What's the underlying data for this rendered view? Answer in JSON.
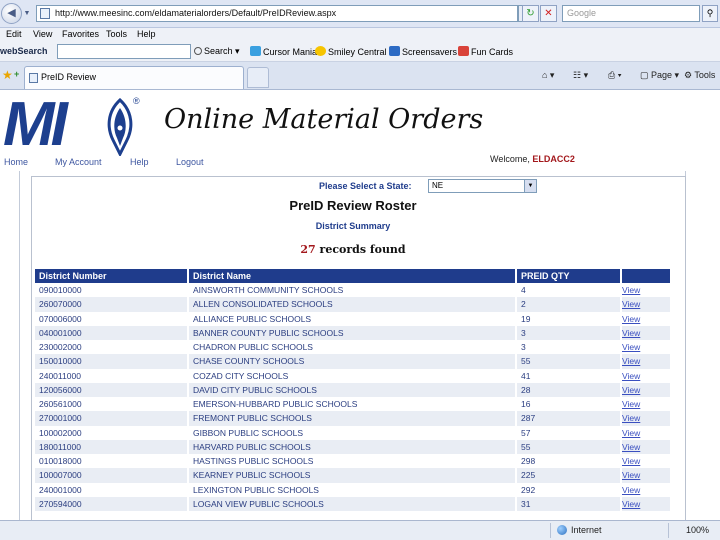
{
  "browser": {
    "address": "http://www.meesinc.com/eldamaterialorders/Default/PreIDReview.aspx",
    "search_placeholder": "Google",
    "menu": [
      "Edit",
      "View",
      "Favorites",
      "Tools",
      "Help"
    ],
    "toolbar": {
      "websearch_label": "webSearch",
      "search_button": "Search",
      "cursor_mania": "Cursor Mania",
      "smiley_central": "Smiley Central",
      "screensavers": "Screensavers",
      "fun_cards": "Fun Cards"
    },
    "tab_title": "PreID Review",
    "commands": {
      "page": "Page",
      "tools": "Tools"
    },
    "status": {
      "zone": "Internet",
      "zoom": "100%"
    }
  },
  "site": {
    "logo_text": "MI",
    "logo_reg": "®",
    "title": "Online Material Orders",
    "nav": {
      "home": "Home",
      "account": "My Account",
      "help": "Help",
      "logout": "Logout"
    },
    "welcome_prefix": "Welcome,",
    "welcome_user": "ELDACC2"
  },
  "page": {
    "state_label": "Please Select a State:",
    "state_value": "NE",
    "roster_title": "PreID Review Roster",
    "district_summary": "District Summary",
    "record_count": "27",
    "records_suffix": "records found",
    "columns": [
      "District Number",
      "District Name",
      "PREID QTY",
      ""
    ],
    "view_label": "View",
    "rows": [
      {
        "number": "090010000",
        "name": "AINSWORTH COMMUNITY SCHOOLS",
        "qty": "4"
      },
      {
        "number": "260070000",
        "name": "ALLEN CONSOLIDATED SCHOOLS",
        "qty": "2"
      },
      {
        "number": "070006000",
        "name": "ALLIANCE PUBLIC SCHOOLS",
        "qty": "19"
      },
      {
        "number": "040001000",
        "name": "BANNER COUNTY PUBLIC SCHOOLS",
        "qty": "3"
      },
      {
        "number": "230002000",
        "name": "CHADRON PUBLIC SCHOOLS",
        "qty": "3"
      },
      {
        "number": "150010000",
        "name": "CHASE COUNTY SCHOOLS",
        "qty": "55"
      },
      {
        "number": "240011000",
        "name": "COZAD CITY SCHOOLS",
        "qty": "41"
      },
      {
        "number": "120056000",
        "name": "DAVID CITY PUBLIC SCHOOLS",
        "qty": "28"
      },
      {
        "number": "260561000",
        "name": "EMERSON-HUBBARD PUBLIC SCHOOLS",
        "qty": "16"
      },
      {
        "number": "270001000",
        "name": "FREMONT PUBLIC SCHOOLS",
        "qty": "287"
      },
      {
        "number": "100002000",
        "name": "GIBBON PUBLIC SCHOOLS",
        "qty": "57"
      },
      {
        "number": "180011000",
        "name": "HARVARD PUBLIC SCHOOLS",
        "qty": "55"
      },
      {
        "number": "010018000",
        "name": "HASTINGS PUBLIC SCHOOLS",
        "qty": "298"
      },
      {
        "number": "100007000",
        "name": "KEARNEY PUBLIC SCHOOLS",
        "qty": "225"
      },
      {
        "number": "240001000",
        "name": "LEXINGTON PUBLIC SCHOOLS",
        "qty": "292"
      },
      {
        "number": "270594000",
        "name": "LOGAN VIEW PUBLIC SCHOOLS",
        "qty": "31"
      }
    ]
  }
}
